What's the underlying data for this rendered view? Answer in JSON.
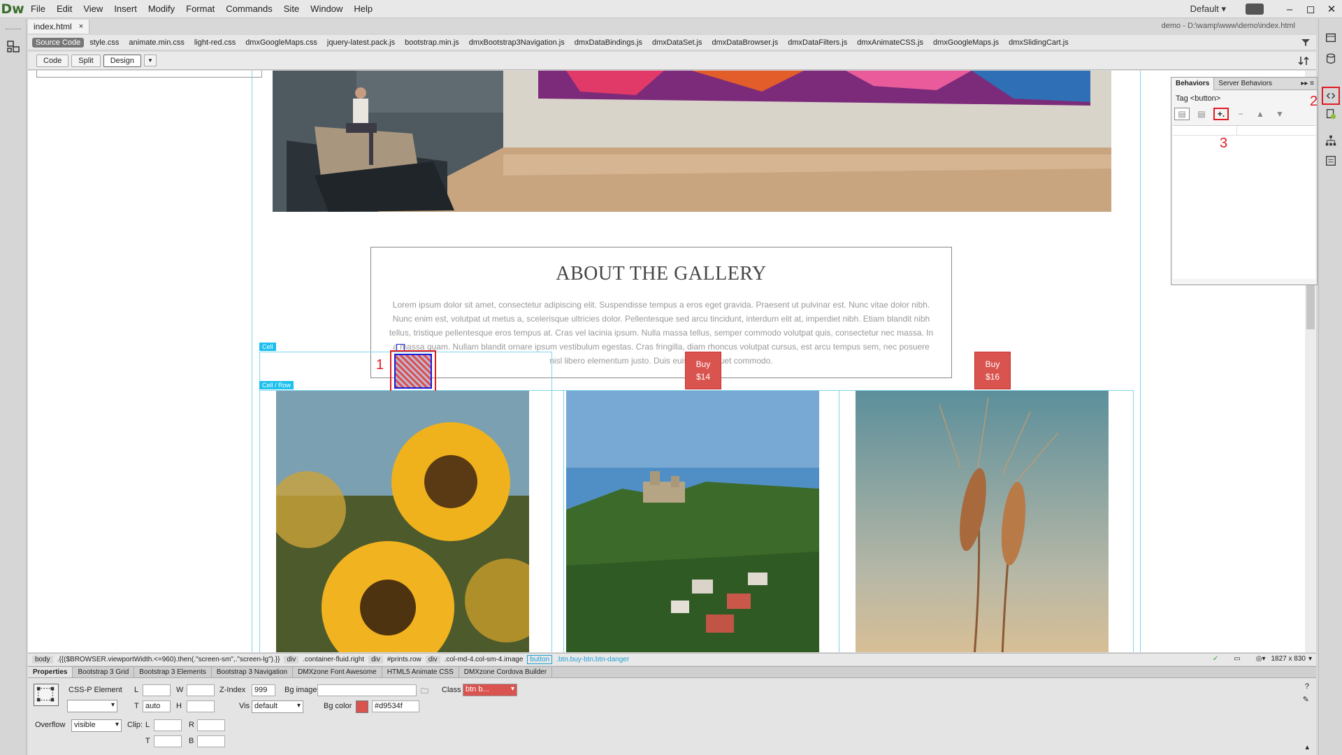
{
  "app": {
    "logo": "Dw"
  },
  "menu": [
    "File",
    "Edit",
    "View",
    "Insert",
    "Modify",
    "Format",
    "Commands",
    "Site",
    "Window",
    "Help"
  ],
  "workspace": "Default",
  "document": {
    "tab": "index.html",
    "close": "×",
    "path": "demo - D:\\wamp\\www\\demo\\index.html"
  },
  "related_files": {
    "source": "Source Code",
    "files": [
      "style.css",
      "animate.min.css",
      "light-red.css",
      "dmxGoogleMaps.css",
      "jquery-latest.pack.js",
      "bootstrap.min.js",
      "dmxBootstrap3Navigation.js",
      "dmxDataBindings.js",
      "dmxDataSet.js",
      "dmxDataBrowser.js",
      "dmxDataFilters.js",
      "dmxAnimateCSS.js",
      "dmxGoogleMaps.js",
      "dmxSlidingCart.js"
    ]
  },
  "views": {
    "code": "Code",
    "split": "Split",
    "design": "Design"
  },
  "page": {
    "about_title": "ABOUT THE GALLERY",
    "about_text": "Lorem ipsum dolor sit amet, consectetur adipiscing elit. Suspendisse tempus a eros eget gravida. Praesent ut pulvinar est. Nunc vitae dolor nibh. Nunc enim est, volutpat ut metus a, scelerisque ultricies dolor. Pellentesque sed arcu tincidunt, interdum elit at, imperdiet nibh. Etiam blandit nibh tellus, tristique pellentesque eros tempus at. Cras vel lacinia ipsum. Nulla massa tellus, semper commodo volutpat quis, consectetur nec massa. In a massa quam. Nullam blandit ornare ipsum vestibulum egestas. Cras fringilla, diam rhoncus volutpat cursus, est arcu tempus sem, nec posuere nisl libero elementum justo. Duis euismod aliquet commodo.",
    "cell_tag": "Cell",
    "cell_row_tag": "Cell / Row",
    "buttons": [
      {
        "label": "Buy",
        "price": "$14"
      },
      {
        "label": "Buy",
        "price": "$16"
      }
    ],
    "markers": {
      "one": "1",
      "two": "2",
      "three": "3"
    }
  },
  "behaviors_panel": {
    "tabs": [
      "Behaviors",
      "Server Behaviors"
    ],
    "tag": "Tag <button>",
    "add": "+.",
    "remove": "−"
  },
  "tag_selector": {
    "items": [
      "body",
      ".{{($BROWSER.viewportWidth.<=960).then(.\"screen-sm\",.\"screen-lg\").}}",
      "div",
      ".container-fluid.right",
      "div",
      "#prints.row",
      "div",
      ".col-md-4.col-sm-4.image",
      "button",
      ".btn.buy-btn.btn-danger"
    ],
    "size": "1827 x 830"
  },
  "properties": {
    "tabs": [
      "Properties",
      "Bootstrap 3 Grid",
      "Bootstrap 3 Elements",
      "Bootstrap 3 Navigation",
      "DMXzone Font Awesome",
      "HTML5 Animate CSS",
      "DMXzone Cordova Builder"
    ],
    "element_type": "CSS-P Element",
    "L_label": "L",
    "W_label": "W",
    "zindex_label": "Z-Index",
    "zindex": "999",
    "bgimage_label": "Bg image",
    "class_label": "Class",
    "class_value": "btn b...",
    "T_label": "T",
    "T_value": "auto",
    "H_label": "H",
    "vis_label": "Vis",
    "vis_value": "default",
    "bgcolor_label": "Bg color",
    "bgcolor_value": "#d9534f",
    "overflow_label": "Overflow",
    "overflow_value": "visible",
    "clip_label": "Clip:",
    "clip_L": "L",
    "clip_R": "R",
    "clip_T": "T",
    "clip_B": "B"
  },
  "colors": {
    "button": "#d9534f",
    "accent": "#e31b23",
    "guide": "#7fd5ee"
  }
}
